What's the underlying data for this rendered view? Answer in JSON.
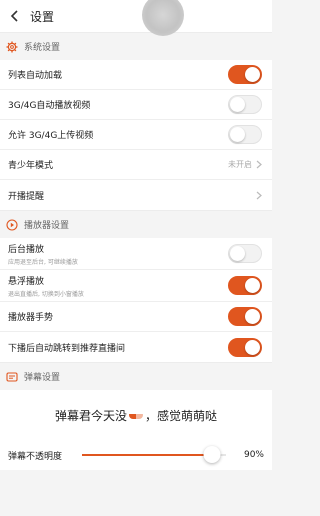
{
  "header": {
    "title": "设置",
    "back_icon": "chevron-left-icon"
  },
  "colors": {
    "accent": "#e0561f",
    "section_bg": "#f4f4f4"
  },
  "sections": {
    "system": {
      "title": "系统设置",
      "icon": "gear-icon",
      "rows": [
        {
          "label": "列表自动加载",
          "toggle": true
        },
        {
          "label": "3G/4G自动播放视频",
          "toggle": false
        },
        {
          "label": "允许 3G/4G上传视频",
          "toggle": false
        },
        {
          "label": "青少年模式",
          "value": "未开启"
        },
        {
          "label": "开播提醒"
        }
      ]
    },
    "player": {
      "title": "播放器设置",
      "icon": "play-circle-icon",
      "rows": [
        {
          "label": "后台播放",
          "sub": "应用退至后台, 可继续播放",
          "toggle": false
        },
        {
          "label": "悬浮播放",
          "sub": "退出直播后, 切换到小窗播放",
          "toggle": true
        },
        {
          "label": "播放器手势",
          "toggle": true
        },
        {
          "label": "下播后自动跳转到推荐直播间",
          "toggle": true
        }
      ]
    },
    "danmaku": {
      "title": "弹幕设置",
      "icon": "danmaku-icon",
      "preview_before": "弹幕君今天没",
      "preview_emoji": "pill-icon",
      "preview_after": "，感觉萌萌哒",
      "opacity_label": "弹幕不透明度",
      "opacity_value": "90%",
      "opacity_fraction": 0.9
    }
  }
}
